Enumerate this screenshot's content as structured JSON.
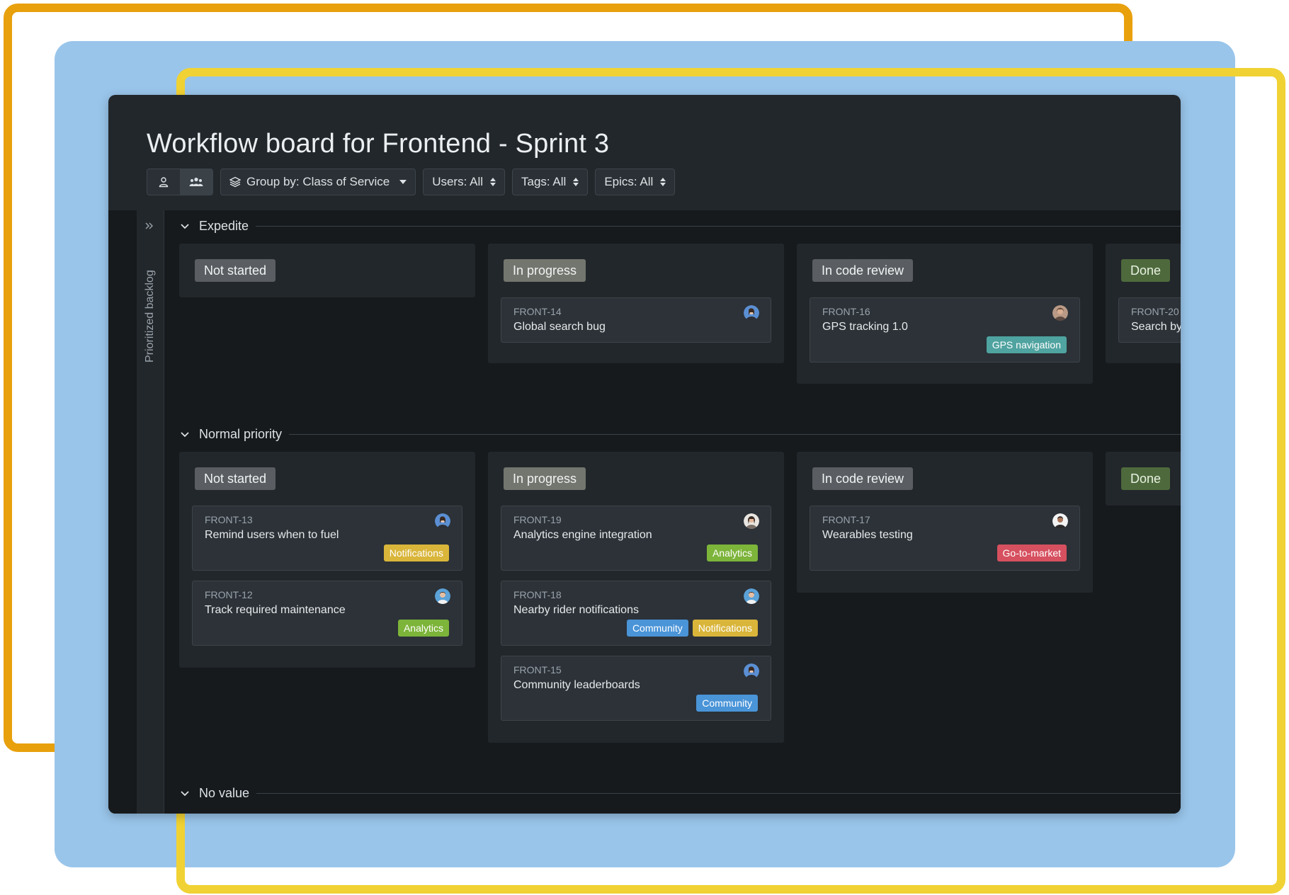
{
  "board": {
    "title": "Workflow board for Frontend - Sprint 3",
    "toolbar": {
      "view_toggle": [
        "person-icon",
        "people-icon"
      ],
      "group_by": "Group by: Class of Service",
      "users": "Users: All",
      "tags": "Tags: All",
      "epics": "Epics: All"
    },
    "backlog_label": "Prioritized backlog",
    "lanes": [
      {
        "title": "Expedite",
        "columns": [
          {
            "status": "Not started",
            "cards": []
          },
          {
            "status": "In progress",
            "cards": [
              {
                "key": "FRONT-14",
                "name": "Global search bug",
                "tags": []
              }
            ]
          },
          {
            "status": "In code review",
            "cards": [
              {
                "key": "FRONT-16",
                "name": "GPS tracking 1.0",
                "tags": [
                  "GPS navigation"
                ]
              }
            ]
          },
          {
            "status": "Done",
            "cards": [
              {
                "key": "FRONT-20",
                "name": "Search by",
                "tags": []
              }
            ]
          }
        ]
      },
      {
        "title": "Normal priority",
        "columns": [
          {
            "status": "Not started",
            "cards": [
              {
                "key": "FRONT-13",
                "name": "Remind users when to fuel",
                "tags": [
                  "Notifications"
                ]
              },
              {
                "key": "FRONT-12",
                "name": "Track required maintenance",
                "tags": [
                  "Analytics"
                ]
              }
            ]
          },
          {
            "status": "In progress",
            "cards": [
              {
                "key": "FRONT-19",
                "name": "Analytics engine integration",
                "tags": [
                  "Analytics"
                ]
              },
              {
                "key": "FRONT-18",
                "name": "Nearby rider notifications",
                "tags": [
                  "Community",
                  "Notifications"
                ]
              },
              {
                "key": "FRONT-15",
                "name": "Community leaderboards",
                "tags": [
                  "Community"
                ]
              }
            ]
          },
          {
            "status": "In code review",
            "cards": [
              {
                "key": "FRONT-17",
                "name": "Wearables testing",
                "tags": [
                  "Go-to-market"
                ]
              }
            ]
          },
          {
            "status": "Done",
            "cards": []
          }
        ]
      },
      {
        "title": "No value",
        "columns": []
      }
    ]
  },
  "colors": {
    "frame_orange": "#E8A00C",
    "frame_blue": "#99C5EA",
    "frame_yellow": "#F0D234",
    "app_bg": "#22272B",
    "board_bg": "#161A1D",
    "tag_notifications": "#D9B53A",
    "tag_analytics": "#7DB43A",
    "tag_community": "#4A94D8",
    "tag_gps_navigation": "#4FA3A0",
    "tag_go_to_market": "#D6505F",
    "status_done": "#4E6A3D"
  }
}
